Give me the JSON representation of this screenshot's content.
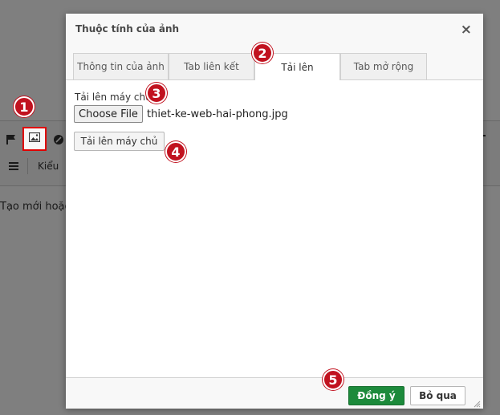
{
  "background": {
    "toolbar_style_label": "Kiểu",
    "editor_text": "Tạo mới hoặc C"
  },
  "dialog": {
    "title": "Thuộc tính của ảnh",
    "close_symbol": "×",
    "tabs": [
      {
        "label": "Thông tin của ảnh",
        "active": false
      },
      {
        "label": "Tab liên kết",
        "active": false
      },
      {
        "label": "Tải lên",
        "active": true
      },
      {
        "label": "Tab mở rộng",
        "active": false
      }
    ],
    "upload": {
      "field_label": "Tải lên máy chủ",
      "choose_file_label": "Choose File",
      "file_name": "thiet-ke-web-hai-phong.jpg",
      "send_button_label": "Tải lên máy chủ"
    },
    "footer": {
      "ok_label": "Đồng ý",
      "cancel_label": "Bỏ qua"
    }
  },
  "step_markers": [
    "1",
    "2",
    "3",
    "4",
    "5"
  ],
  "colors": {
    "ok_button": "#1c8a3b",
    "step_marker": "#c1121f",
    "highlight_box": "#e00000"
  }
}
